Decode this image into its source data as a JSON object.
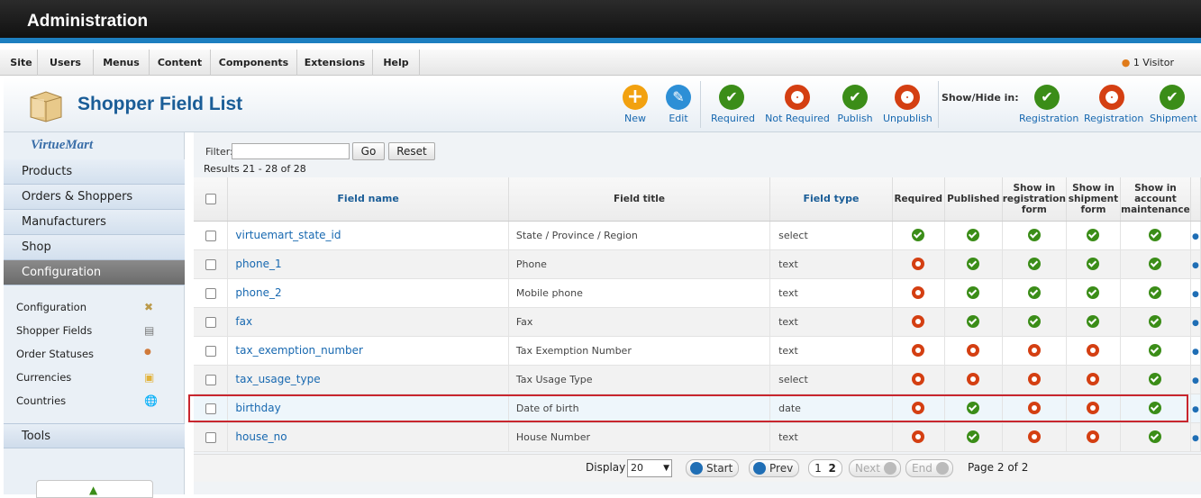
{
  "app": {
    "title": "Administration"
  },
  "menu": {
    "items": [
      "Site",
      "Users",
      "Menus",
      "Content",
      "Components",
      "Extensions",
      "Help"
    ],
    "visitors": "1 Visitor"
  },
  "page": {
    "title": "Shopper Field List"
  },
  "toolbar": {
    "new": "New",
    "edit": "Edit",
    "required": "Required",
    "not_required": "Not Required",
    "publish": "Publish",
    "unpublish": "Unpublish",
    "showhide_label": "Show/Hide in:",
    "registration_show": "Registration",
    "registration_hide": "Registration",
    "shipment_show": "Shipment"
  },
  "sidebar": {
    "logo": "VirtueMart",
    "items": [
      "Products",
      "Orders & Shoppers",
      "Manufacturers",
      "Shop",
      "Configuration"
    ],
    "active": "Configuration",
    "subitems": [
      {
        "label": "Configuration",
        "icon": "tools-icon"
      },
      {
        "label": "Shopper Fields",
        "icon": "form-icon"
      },
      {
        "label": "Order Statuses",
        "icon": "status-icon"
      },
      {
        "label": "Currencies",
        "icon": "coins-icon"
      },
      {
        "label": "Countries",
        "icon": "globe-icon"
      }
    ],
    "tools": "Tools"
  },
  "filter": {
    "label": "Filter:",
    "value": "",
    "go": "Go",
    "reset": "Reset",
    "results": "Results 21 - 28 of 28"
  },
  "table": {
    "headers": {
      "field_name": "Field name",
      "field_title": "Field title",
      "field_type": "Field type",
      "required": "Required",
      "published": "Published",
      "registration": "Show in registration form",
      "shipment": "Show in shipment form",
      "account": "Show in account maintenance"
    },
    "rows": [
      {
        "name": "virtuemart_state_id",
        "title": "State / Province / Region",
        "type": "select",
        "required": true,
        "published": true,
        "registration": true,
        "shipment": true,
        "account": true
      },
      {
        "name": "phone_1",
        "title": "Phone",
        "type": "text",
        "required": false,
        "published": true,
        "registration": true,
        "shipment": true,
        "account": true
      },
      {
        "name": "phone_2",
        "title": "Mobile phone",
        "type": "text",
        "required": false,
        "published": true,
        "registration": true,
        "shipment": true,
        "account": true
      },
      {
        "name": "fax",
        "title": "Fax",
        "type": "text",
        "required": false,
        "published": true,
        "registration": true,
        "shipment": true,
        "account": true
      },
      {
        "name": "tax_exemption_number",
        "title": "Tax Exemption Number",
        "type": "text",
        "required": false,
        "published": false,
        "registration": false,
        "shipment": false,
        "account": true
      },
      {
        "name": "tax_usage_type",
        "title": "Tax Usage Type",
        "type": "select",
        "required": false,
        "published": false,
        "registration": false,
        "shipment": false,
        "account": true
      },
      {
        "name": "birthday",
        "title": "Date of birth",
        "type": "date",
        "required": false,
        "published": true,
        "registration": false,
        "shipment": false,
        "account": true
      },
      {
        "name": "house_no",
        "title": "House Number",
        "type": "text",
        "required": false,
        "published": true,
        "registration": false,
        "shipment": false,
        "account": true
      }
    ]
  },
  "pagination": {
    "display_label": "Display #",
    "display_value": "20",
    "start": "Start",
    "prev": "Prev",
    "page1": "1",
    "page2": "2",
    "next": "Next",
    "end": "End",
    "page_info": "Page 2 of 2"
  },
  "colors": {
    "accent": "#1768b0",
    "ok": "#3b8d18",
    "no": "#d43f12",
    "highlight": "#c8262e"
  }
}
